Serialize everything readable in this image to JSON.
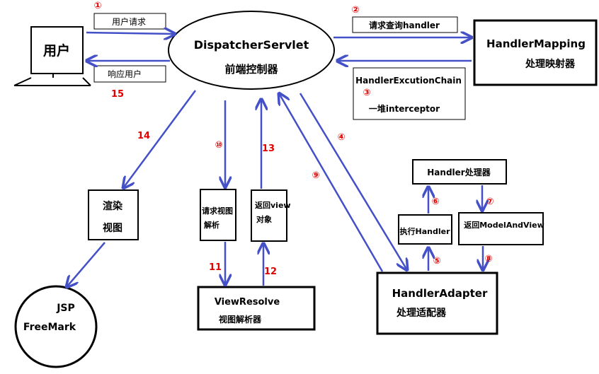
{
  "colors": {
    "arrow": "#4450c8",
    "step": "#e00000",
    "stroke": "#000000"
  },
  "icons": {
    "monitor": "computer-monitor-icon"
  },
  "nodes": {
    "user": "用户",
    "dispatcher_title": "DispatcherServlet",
    "dispatcher_sub": "前端控制器",
    "mapping_title": "HandlerMapping",
    "mapping_sub": "处理映射器",
    "chain_title": "HandlerExcutionChain",
    "chain_step": "③",
    "chain_sub": "一堆interceptor",
    "handler": "Handler处理器",
    "exec_handler": "执行Handler",
    "return_mav": "返回ModelAndView",
    "adapter_title": "HandlerAdapter",
    "adapter_sub": "处理适配器",
    "resolve_title": "ViewResolve",
    "resolve_sub": "视图解析器",
    "req_view_line1": "请求视图",
    "req_view_line2": "解析",
    "ret_view_line1": "返回view",
    "ret_view_line2": "对象",
    "render_line1": "渲染",
    "render_line2": "视图",
    "jsp": "JSP",
    "freemark": "FreeMark"
  },
  "labels": {
    "user_request": "用户请求",
    "user_response": "响应用户",
    "request_handler": "请求查询handler"
  },
  "steps": {
    "s1": "①",
    "s2": "②",
    "s4": "④",
    "s5": "⑤",
    "s6": "⑥",
    "s7": "⑦",
    "s8": "⑧",
    "s9": "⑨",
    "s10": "⑩",
    "s11": "11",
    "s12": "12",
    "s13": "13",
    "s14": "14",
    "s15": "15"
  }
}
